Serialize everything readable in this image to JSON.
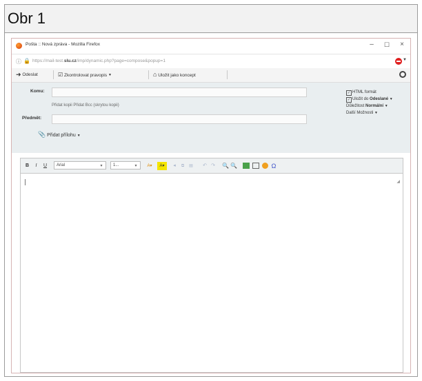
{
  "figure": {
    "caption": "Obr 1"
  },
  "window": {
    "title": "Pošta :: Nová zpráva - Mozilla Firefox",
    "controls": {
      "minimize": "–",
      "maximize": "☐",
      "close": "×"
    }
  },
  "url": {
    "prefix": "https://mail-test.",
    "domain": "slu.cz",
    "path": "/imp/dynamic.php?page=compose&popup=1"
  },
  "toolbar": {
    "send_label": "Odeslat",
    "spellcheck_label": "Zkontrolovat pravopis",
    "draft_label": "Uložit jako koncept"
  },
  "headers": {
    "to_label": "Komu:",
    "cc_links": "Přidat kopii   Přidat Bcc (skrytou kopii)",
    "subject_label": "Předmět:",
    "attach_label": "Přidat přílohu"
  },
  "options": {
    "html_format": "HTML formát",
    "save_in": "Uložit do",
    "save_folder": "Odeslané",
    "priority": "Důležitost",
    "priority_value": "Normální",
    "more_options": "Další Možnosti"
  },
  "editor": {
    "bold": "B",
    "italic": "I",
    "underline": "U",
    "font": "Arial",
    "size": "1...",
    "omega": "Ω"
  }
}
